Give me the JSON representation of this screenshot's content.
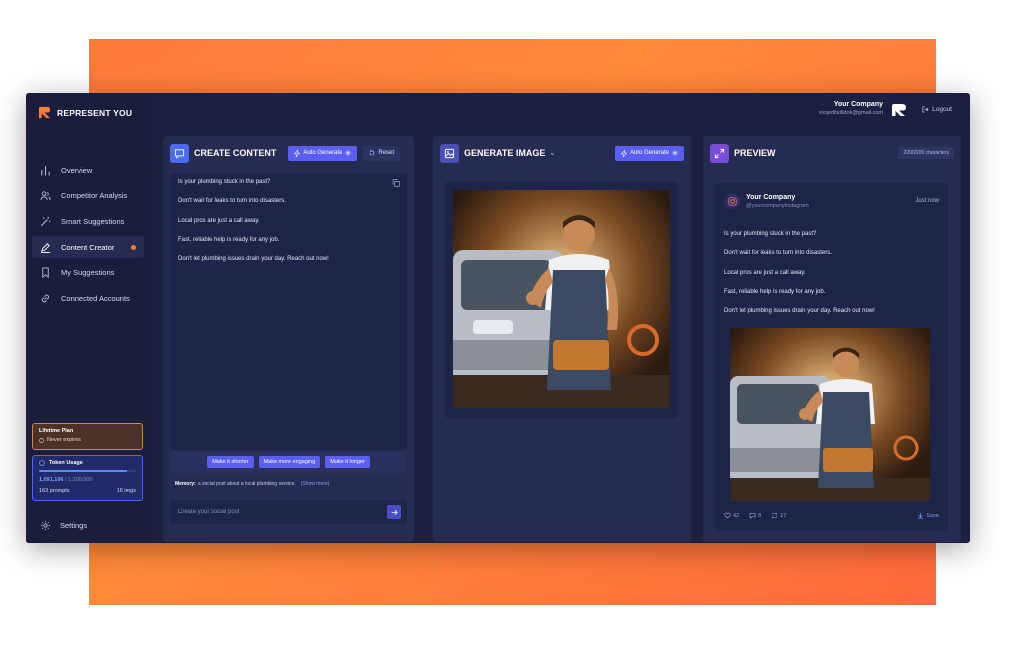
{
  "brand": {
    "name": "REPRESENT YOU"
  },
  "sidebar": {
    "items": [
      {
        "label": "Overview",
        "icon": "chart-bar-icon"
      },
      {
        "label": "Competitor Analysis",
        "icon": "users-icon"
      },
      {
        "label": "Smart Suggestions",
        "icon": "magic-wand-icon"
      },
      {
        "label": "Content Creator",
        "icon": "pen-icon",
        "active": true
      },
      {
        "label": "My Suggestions",
        "icon": "bookmark-icon"
      },
      {
        "label": "Connected Accounts",
        "icon": "link-icon"
      }
    ],
    "plan": {
      "title": "Lifetime Plan",
      "subtitle": "Never expires"
    },
    "tokens": {
      "title": "Token Usage",
      "used": "1,091,106",
      "total": "/ 1,200,000",
      "usage_fraction": 0.91,
      "prompts": "163 prompts",
      "imgs": "16 imgs"
    },
    "settings_label": "Settings"
  },
  "header": {
    "user_name": "Your Company",
    "user_email": "exqeditstiktok@gmail.com",
    "logout_label": "Logout"
  },
  "create_content": {
    "title": "CREATE CONTENT",
    "auto_label": "Auto Generate",
    "reset_label": "Reset",
    "lines": [
      "Is your plumbing stuck in the past?",
      "Don't wait for leaks to turn into disasters.",
      "Local pros are just a call away.",
      "Fast, reliable help is ready for any job.",
      "Don't let plumbing issues drain your day. Reach out now!"
    ],
    "chips": [
      "Make it shorter",
      "Make more engaging",
      "Make it longer"
    ],
    "memory_label": "Memory:",
    "memory_text": "a social post about a local plumbing service,",
    "memory_more": "(Show more)",
    "input_placeholder": "Create your social post"
  },
  "generate_image": {
    "title": "GENERATE IMAGE",
    "auto_label": "Auto Generate"
  },
  "preview": {
    "title": "PREVIEW",
    "char_count": "220/2200 characters",
    "post_name": "Your Company",
    "post_handle": "@yourcompanyinstagram",
    "post_time": "Just now",
    "lines": [
      "Is your plumbing stuck in the past?",
      "Don't wait for leaks to turn into disasters.",
      "Local pros are just a call away.",
      "Fast, reliable help is ready for any job.",
      "Don't let plumbing issues drain your day. Reach out now!"
    ],
    "likes": "42",
    "comments": "8",
    "shares": "17",
    "save_label": "Save"
  },
  "colors": {
    "accent": "#5a5ff0",
    "brand_orange": "#ff7a3d",
    "panel": "#262b52",
    "app_bg": "#1c2040"
  }
}
